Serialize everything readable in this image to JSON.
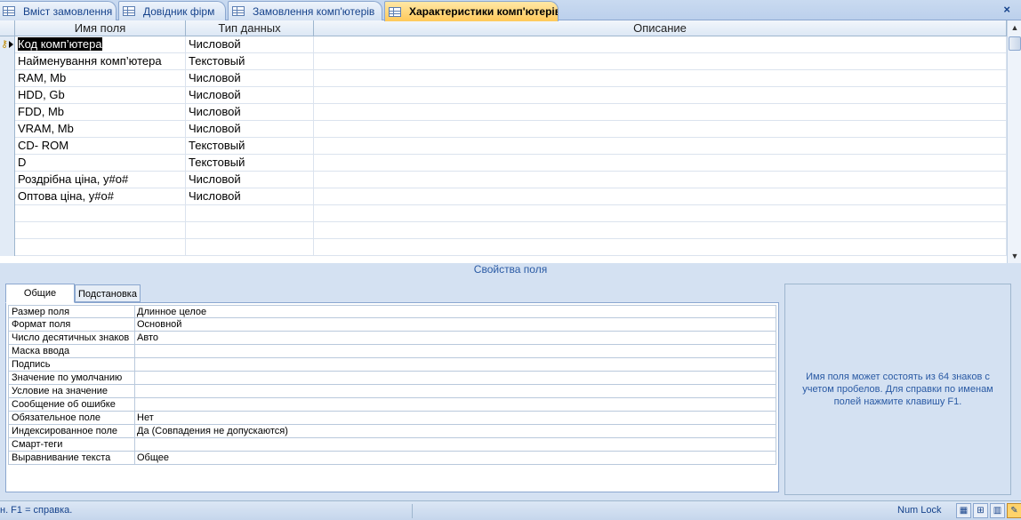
{
  "tabs": [
    {
      "label": "Вміст замовлення",
      "active": false
    },
    {
      "label": "Довідник фірм",
      "active": false
    },
    {
      "label": "Замовлення комп'ютерів",
      "active": false
    },
    {
      "label": "Характеристики комп'ютерів",
      "active": true
    }
  ],
  "close_icon": "×",
  "grid": {
    "headers": {
      "name": "Имя поля",
      "type": "Тип данных",
      "description": "Описание"
    },
    "rows": [
      {
        "name": "Код комп’ютера",
        "type": "Числовой",
        "description": ""
      },
      {
        "name": "Найменування комп’ютера",
        "type": "Текстовый",
        "description": ""
      },
      {
        "name": "RAM, Mb",
        "type": "Числовой",
        "description": ""
      },
      {
        "name": "HDD, Gb",
        "type": "Числовой",
        "description": ""
      },
      {
        "name": "FDD, Mb",
        "type": "Числовой",
        "description": ""
      },
      {
        "name": "VRAM, Mb",
        "type": "Числовой",
        "description": ""
      },
      {
        "name": "CD- ROM",
        "type": "Текстовый",
        "description": ""
      },
      {
        "name": "D",
        "type": "Текстовый",
        "description": ""
      },
      {
        "name": "Роздрібна ціна, у#о#",
        "type": "Числовой",
        "description": ""
      },
      {
        "name": "Оптова ціна, у#о#",
        "type": "Числовой",
        "description": ""
      }
    ],
    "primary_key_icon": "key-icon"
  },
  "field_properties": {
    "title": "Свойства поля",
    "tabs": {
      "general": "Общие",
      "lookup": "Подстановка"
    },
    "properties": [
      {
        "name": "Размер поля",
        "value": "Длинное целое"
      },
      {
        "name": "Формат поля",
        "value": "Основной"
      },
      {
        "name": "Число десятичных знаков",
        "value": "Авто"
      },
      {
        "name": "Маска ввода",
        "value": ""
      },
      {
        "name": "Подпись",
        "value": ""
      },
      {
        "name": "Значение по умолчанию",
        "value": ""
      },
      {
        "name": "Условие на значение",
        "value": ""
      },
      {
        "name": "Сообщение об ошибке",
        "value": ""
      },
      {
        "name": "Обязательное поле",
        "value": "Нет"
      },
      {
        "name": "Индексированное поле",
        "value": "Да (Совпадения не допускаются)"
      },
      {
        "name": "Смарт-теги",
        "value": ""
      },
      {
        "name": "Выравнивание текста",
        "value": "Общее"
      }
    ],
    "help_text": "Имя поля может состоять из 64 знаков с учетом пробелов.  Для справки по именам полей нажмите клавишу F1."
  },
  "statusbar": {
    "text": "н.  F1 = справка.",
    "num_lock": "Num Lock"
  },
  "colors": {
    "active_tab": "#ffc95a",
    "accent": "#15428b"
  }
}
